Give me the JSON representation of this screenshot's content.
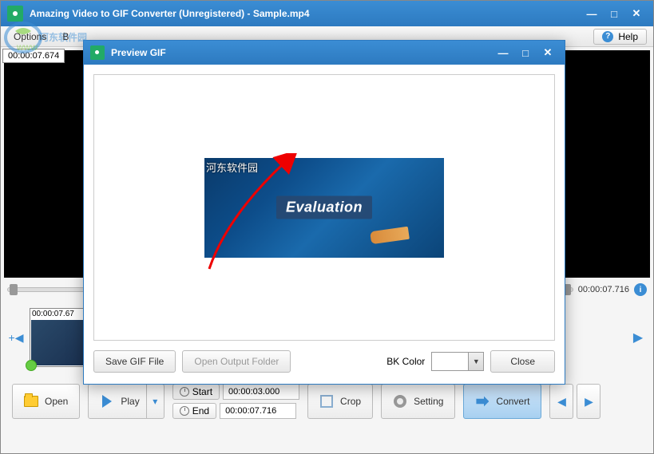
{
  "main": {
    "title": "Amazing Video to GIF Converter (Unregistered) - Sample.mp4",
    "menu_options": "Options",
    "menu_b": "B",
    "help_label": "Help",
    "watermark_cn": "河东软件园",
    "timestamp_tl": "00:00:07.674",
    "slider_time": "00:00:07.716",
    "thumb_ts": "00:00:07.67"
  },
  "bottom": {
    "open": "Open",
    "play": "Play",
    "start_label": "Start",
    "end_label": "End",
    "start_time": "00:00:03.000",
    "end_time": "00:00:07.716",
    "crop": "Crop",
    "setting": "Setting",
    "convert": "Convert"
  },
  "dialog": {
    "title": "Preview GIF",
    "gif_wm": "河东软件园",
    "gif_eval": "Evaluation",
    "save_btn": "Save GIF File",
    "open_folder_btn": "Open Output Folder",
    "bk_label": "BK Color",
    "close_btn": "Close"
  }
}
